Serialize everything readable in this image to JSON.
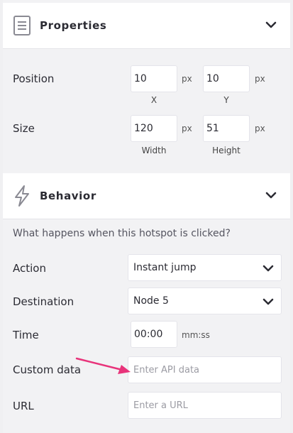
{
  "properties": {
    "title": "Properties",
    "position_label": "Position",
    "size_label": "Size",
    "pos_x": "10",
    "pos_y": "10",
    "width": "120",
    "height": "51",
    "unit": "px",
    "x_label": "X",
    "y_label": "Y",
    "width_label": "Width",
    "height_label": "Height"
  },
  "behavior": {
    "title": "Behavior",
    "question": "What happens when this hotspot is clicked?",
    "action_label": "Action",
    "action_value": "Instant jump",
    "destination_label": "Destination",
    "destination_value": "Node 5",
    "time_label": "Time",
    "time_value": "00:00",
    "time_unit": "mm:ss",
    "custom_label": "Custom data",
    "custom_placeholder": "Enter API data",
    "url_label": "URL",
    "url_placeholder": "Enter a URL"
  },
  "colors": {
    "accent_arrow": "#e8337a"
  },
  "icons": {
    "properties": "document-icon",
    "behavior": "lightning-icon",
    "collapse": "chevron-down-icon"
  }
}
